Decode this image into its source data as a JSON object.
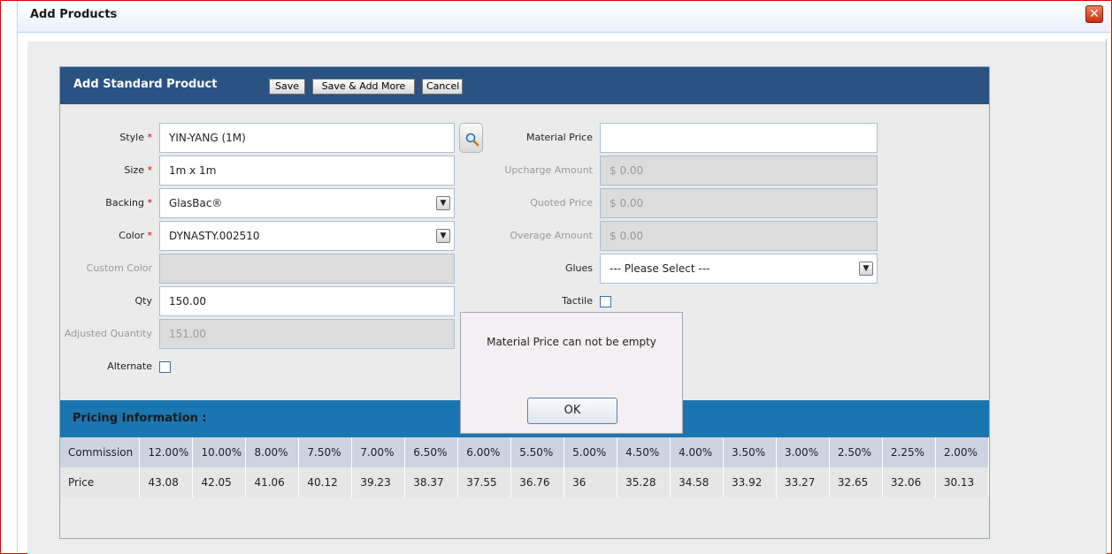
{
  "window": {
    "title": "Add Products",
    "close_symbol": "✕"
  },
  "panel": {
    "title": "Add Standard Product",
    "save_label": "Save",
    "save_add_more_label": "Save & Add More",
    "cancel_label": "Cancel"
  },
  "form": {
    "style": {
      "label": "Style",
      "value": "YIN-YANG (1M)"
    },
    "size": {
      "label": "Size",
      "value": "1m x 1m"
    },
    "backing": {
      "label": "Backing",
      "value": "GlasBac®"
    },
    "color": {
      "label": "Color",
      "value": "DYNASTY.002510"
    },
    "custom_color": {
      "label": "Custom Color",
      "value": ""
    },
    "qty": {
      "label": "Qty",
      "value": "150.00"
    },
    "adjusted_quantity": {
      "label": "Adjusted Quantity",
      "value": "151.00"
    },
    "alternate": {
      "label": "Alternate"
    },
    "material_price": {
      "label": "Material Price",
      "value": ""
    },
    "upcharge_amount": {
      "label": "Upcharge Amount",
      "value": "$ 0.00"
    },
    "quoted_price": {
      "label": "Quoted Price",
      "value": "$ 0.00"
    },
    "overage_amount": {
      "label": "Overage Amount",
      "value": "$ 0.00"
    },
    "glues": {
      "label": "Glues",
      "value": "--- Please Select ---"
    },
    "tactile": {
      "label": "Tactile"
    },
    "required_marker": "*"
  },
  "pricing": {
    "title": "Pricing Information :",
    "commission_label": "Commission",
    "price_label": "Price",
    "commission": [
      "12.00%",
      "10.00%",
      "8.00%",
      "7.50%",
      "7.00%",
      "6.50%",
      "6.00%",
      "5.50%",
      "5.00%",
      "4.50%",
      "4.00%",
      "3.50%",
      "3.00%",
      "2.50%",
      "2.25%",
      "2.00%"
    ],
    "price": [
      "43.08",
      "42.05",
      "41.06",
      "40.12",
      "39.23",
      "38.37",
      "37.55",
      "36.76",
      "36",
      "35.28",
      "34.58",
      "33.92",
      "33.27",
      "32.65",
      "32.06",
      "30.13"
    ]
  },
  "dialog": {
    "message": "Material Price can not be empty",
    "ok_label": "OK"
  },
  "icons": {
    "search": "magnifier-icon",
    "dropdown": "chevron-down-icon",
    "close": "close-icon"
  },
  "colors": {
    "header": "#2a5283",
    "pricing_header": "#1a76b1",
    "required": "#cc0000"
  }
}
